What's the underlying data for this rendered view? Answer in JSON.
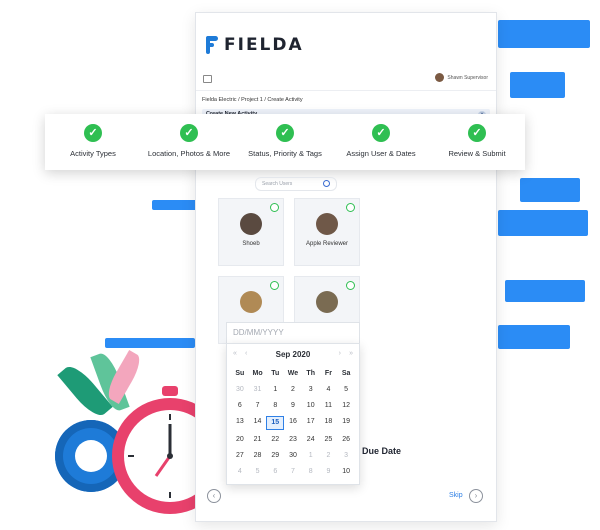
{
  "app": {
    "logo_text": "FIELDA"
  },
  "header": {
    "user_name": "Shawn Supervisor"
  },
  "breadcrumb": "Fielda Electric  /  Project 1  /  Create Activity",
  "modal": {
    "title": "Create New Activity",
    "close_icon": "close-icon"
  },
  "steps": [
    {
      "label": "Activity Types",
      "done": true
    },
    {
      "label": "Location, Photos & More",
      "done": true
    },
    {
      "label": "Status, Priority & Tags",
      "done": true
    },
    {
      "label": "Assign User & Dates",
      "done": true
    },
    {
      "label": "Review & Submit",
      "done": true
    }
  ],
  "search": {
    "placeholder": "Search Users"
  },
  "users": [
    {
      "name": "Shoeb"
    },
    {
      "name": "Apple Reviewer"
    },
    {
      "name": ""
    },
    {
      "name": ""
    }
  ],
  "calendar": {
    "input_placeholder": "DD/MM/YYYY",
    "month": "Sep 2020",
    "weekdays": [
      "Su",
      "Mo",
      "Tu",
      "We",
      "Th",
      "Fr",
      "Sa"
    ],
    "days": [
      [
        "30",
        "31",
        "1",
        "2",
        "3",
        "4",
        "5"
      ],
      [
        "6",
        "7",
        "8",
        "9",
        "10",
        "11",
        "12"
      ],
      [
        "13",
        "14",
        "15",
        "16",
        "17",
        "18",
        "19"
      ],
      [
        "20",
        "21",
        "22",
        "23",
        "24",
        "25",
        "26"
      ],
      [
        "27",
        "28",
        "29",
        "30",
        "1",
        "2",
        "3"
      ],
      [
        "4",
        "5",
        "6",
        "7",
        "8",
        "9",
        "10"
      ]
    ],
    "selected": "15"
  },
  "due_date_label": "Due Date",
  "nav": {
    "skip_label": "Skip"
  },
  "colors": {
    "accent": "#2f80e6",
    "success": "#2fbf52",
    "brand": "#1e7bd8"
  }
}
